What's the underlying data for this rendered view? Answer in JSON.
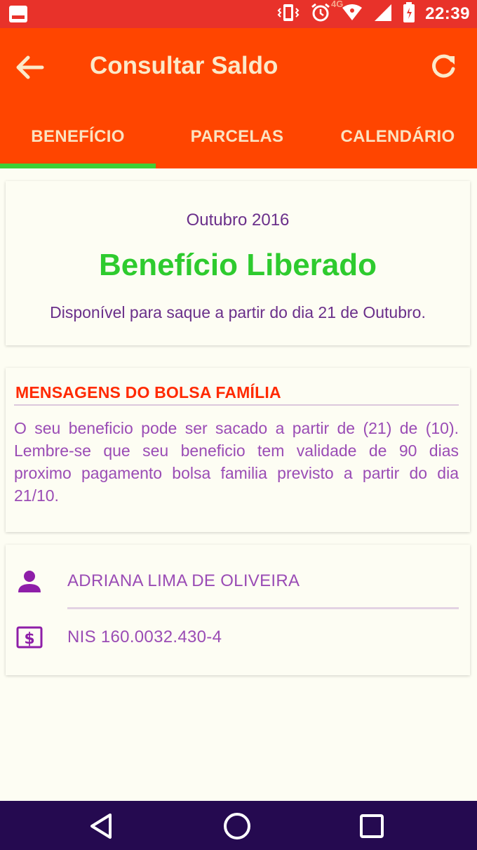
{
  "status_bar": {
    "time": "22:39",
    "network": "4G",
    "icons": [
      "image-icon",
      "vibrate-icon",
      "alarm-icon",
      "wifi-icon",
      "signal-icon",
      "battery-icon"
    ]
  },
  "app_bar": {
    "title": "Consultar Saldo",
    "back_icon": "arrow-left-icon",
    "refresh_icon": "refresh-icon",
    "tabs": [
      {
        "label": "BENEFÍCIO",
        "selected": true
      },
      {
        "label": "PARCELAS",
        "selected": false
      },
      {
        "label": "CALENDÁRIO",
        "selected": false
      }
    ]
  },
  "benefit_card": {
    "period": "Outubro 2016",
    "status": "Benefício Liberado",
    "availability": "Disponível para saque a partir do dia 21 de Outubro."
  },
  "messages_card": {
    "title": "MENSAGENS DO BOLSA FAMÍLIA",
    "body": "O seu beneficio pode ser sacado a partir de (21) de (10). Lembre-se que seu beneficio tem validade de 90 dias proximo pagamento bolsa familia previsto a partir do dia 21/10."
  },
  "holder_card": {
    "name": "ADRIANA LIMA DE OLIVEIRA",
    "nis": "NIS 160.0032.430-4",
    "name_icon": "person-icon",
    "nis_icon": "money-icon"
  },
  "nav_bar": {
    "buttons": [
      "back-triangle-icon",
      "home-circle-icon",
      "recents-square-icon"
    ]
  },
  "colors": {
    "status_bar": "#e8322a",
    "app_bar": "#ff4500",
    "tab_indicator": "#3ecf35",
    "status_green": "#2ecb2e",
    "purple_text": "#6a2f8a",
    "message_title": "#ff2a00",
    "nav_bar": "#250a50",
    "background": "#fdfdf3"
  }
}
